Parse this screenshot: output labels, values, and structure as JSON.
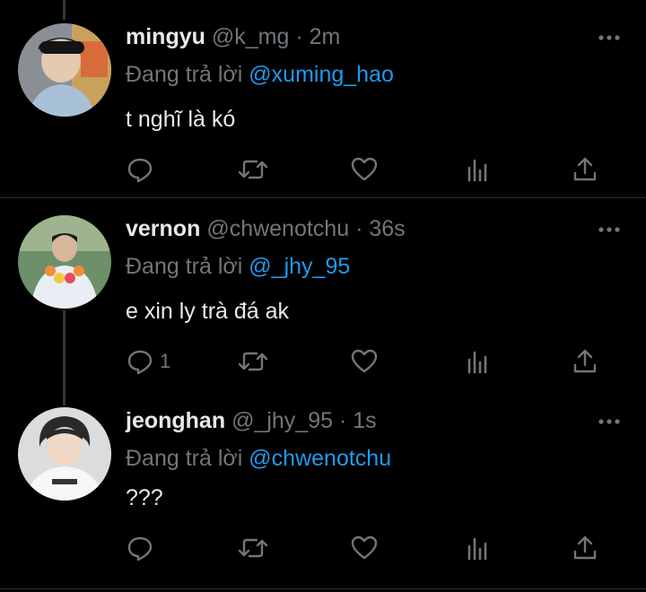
{
  "reply_prefix": "Đang trả lời",
  "tweets": [
    {
      "name": "mingyu",
      "handle": "@k_mg",
      "separator": "·",
      "time": "2m",
      "reply_to": "@xuming_hao",
      "text": "t nghĩ là kó",
      "reply_count": ""
    },
    {
      "name": "vernon",
      "handle": "@chwenotchu",
      "separator": "·",
      "time": "36s",
      "reply_to": "@_jhy_95",
      "text": "e xin ly trà đá ak",
      "reply_count": "1"
    },
    {
      "name": "jeonghan",
      "handle": "@_jhy_95",
      "separator": "·",
      "time": "1s",
      "reply_to": "@chwenotchu",
      "text": "???",
      "reply_count": ""
    }
  ],
  "icons": [
    "reply-icon",
    "retweet-icon",
    "like-icon",
    "views-icon",
    "share-icon",
    "more-icon"
  ],
  "colors": {
    "background": "#000000",
    "text": "#e7e9ea",
    "muted": "#71767b",
    "mention": "#1d9bf0",
    "divider": "#2f3336"
  }
}
